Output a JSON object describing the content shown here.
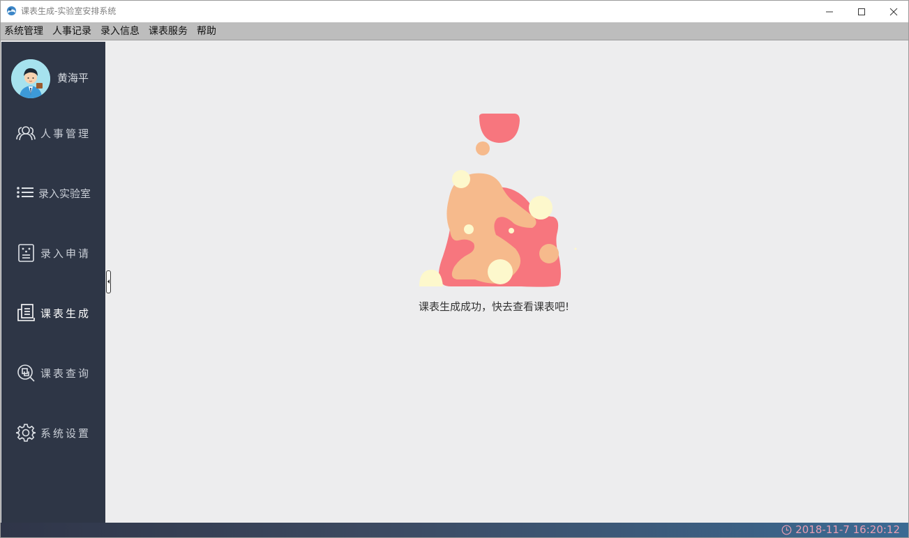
{
  "window": {
    "title": "课表生成-实验室安排系统"
  },
  "menu": [
    {
      "label": "系统管理"
    },
    {
      "label": "人事记录"
    },
    {
      "label": "录入信息"
    },
    {
      "label": "课表服务"
    },
    {
      "label": "帮助"
    }
  ],
  "user": {
    "name": "黄海平"
  },
  "nav": [
    {
      "label": "人事管理",
      "icon": "people-icon"
    },
    {
      "label": "录入实验室",
      "icon": "list-icon"
    },
    {
      "label": "录入申请",
      "icon": "form-icon"
    },
    {
      "label": "课表生成",
      "icon": "document-icon",
      "active": true
    },
    {
      "label": "课表查询",
      "icon": "search-doc-icon"
    },
    {
      "label": "系统设置",
      "icon": "gear-icon"
    }
  ],
  "content": {
    "message": "课表生成成功，快去查看课表吧!"
  },
  "status": {
    "datetime": "2018-11-7 16:20:12"
  },
  "colors": {
    "sidebar": "#2e3646",
    "background": "#ededee",
    "accent_pink": "#f7767e",
    "accent_peach": "#f6ba8c",
    "accent_cream": "#fdf8cc",
    "clock": "#ea9fb3"
  }
}
